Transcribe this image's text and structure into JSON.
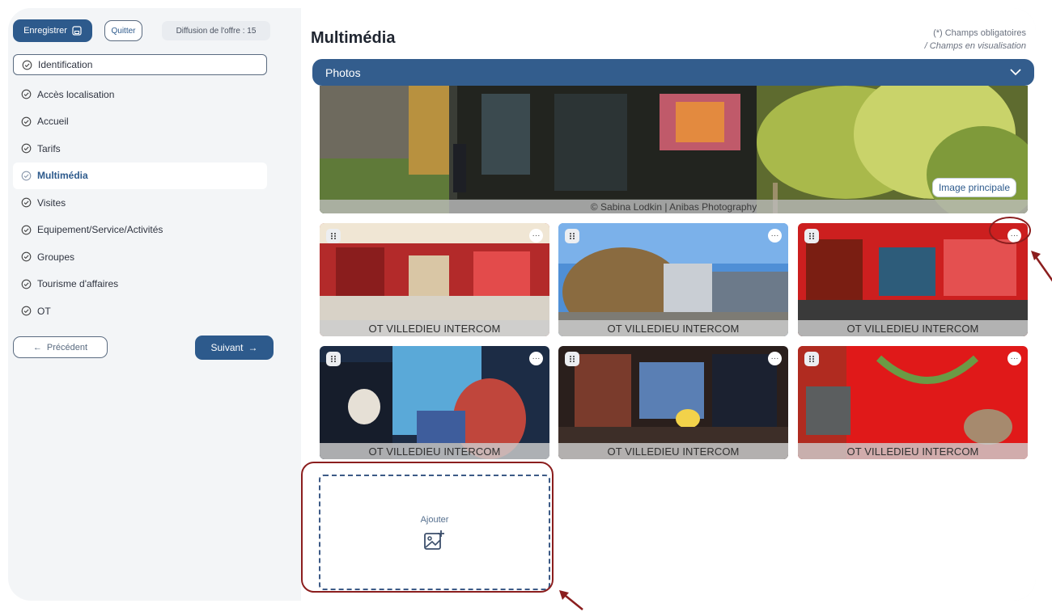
{
  "toolbar": {
    "save_label": "Enregistrer",
    "quit_label": "Quitter",
    "broadcast_label": "Diffusion de l'offre : 15"
  },
  "sidebar": {
    "items": [
      {
        "label": "Identification"
      },
      {
        "label": "Accès localisation"
      },
      {
        "label": "Accueil"
      },
      {
        "label": "Tarifs"
      },
      {
        "label": "Multimédia"
      },
      {
        "label": "Visites"
      },
      {
        "label": "Equipement/Service/Activités"
      },
      {
        "label": "Groupes"
      },
      {
        "label": "Tourisme d'affaires"
      },
      {
        "label": "OT"
      }
    ],
    "prev_label": "Précédent",
    "next_label": "Suivant"
  },
  "main": {
    "title": "Multimédia",
    "legend_required": "(*) Champs obligatoires",
    "legend_view": "/ Champs en visualisation",
    "section_label": "Photos",
    "hero": {
      "credit": "© Sabina Lodkin | Anibas Photography",
      "badge": "Image principale"
    },
    "photos": [
      {
        "caption": "OT VILLEDIEU INTERCOM"
      },
      {
        "caption": "OT VILLEDIEU INTERCOM"
      },
      {
        "caption": "OT VILLEDIEU INTERCOM"
      },
      {
        "caption": "OT VILLEDIEU INTERCOM"
      },
      {
        "caption": "OT VILLEDIEU INTERCOM"
      },
      {
        "caption": "OT VILLEDIEU INTERCOM"
      }
    ],
    "add_label": "Ajouter"
  },
  "colors": {
    "primary": "#2d5a8c",
    "accordion": "#335d8d",
    "annotation": "#8b1e1e"
  }
}
